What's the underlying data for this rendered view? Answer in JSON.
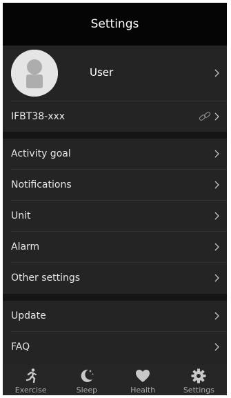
{
  "header": {
    "title": "Settings"
  },
  "profile": {
    "name": "User"
  },
  "device": {
    "name": "IFBT38-xxx"
  },
  "menu_group_1": [
    {
      "label": "Activity goal"
    },
    {
      "label": "Notifications"
    },
    {
      "label": "Unit"
    },
    {
      "label": "Alarm"
    },
    {
      "label": "Other settings"
    }
  ],
  "menu_group_2": [
    {
      "label": "Update"
    },
    {
      "label": "FAQ"
    }
  ],
  "tabs": [
    {
      "label": "Exercise",
      "icon": "running-icon"
    },
    {
      "label": "Sleep",
      "icon": "moon-icon"
    },
    {
      "label": "Health",
      "icon": "heart-icon"
    },
    {
      "label": "Settings",
      "icon": "gear-icon"
    }
  ],
  "colors": {
    "background": "#242424",
    "header": "#050505",
    "text": "#e6e6e6",
    "icon": "#c8c8c8"
  }
}
